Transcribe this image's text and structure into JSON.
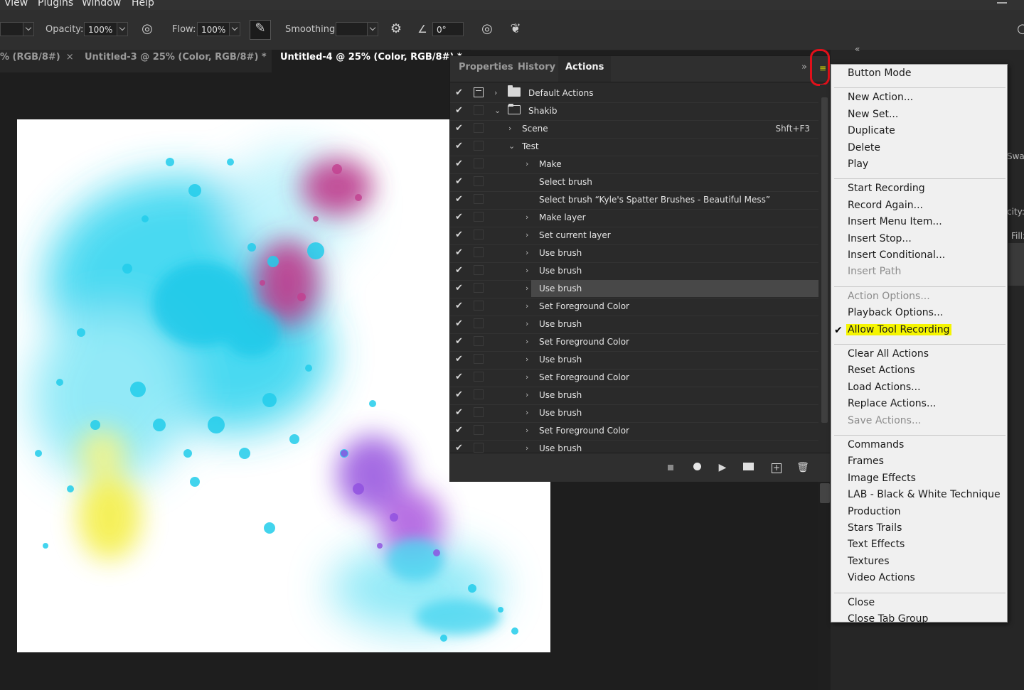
{
  "menubar": {
    "items": [
      "View",
      "Plugins",
      "Window",
      "Help"
    ]
  },
  "options": {
    "opacity_label": "Opacity:",
    "opacity_value": "100%",
    "flow_label": "Flow:",
    "flow_value": "100%",
    "smoothing_label": "Smoothing:",
    "smoothing_value": "",
    "angle_value": "0°"
  },
  "doc_tabs": [
    {
      "label": "% (RGB/8#)",
      "close": "×"
    },
    {
      "label": "Untitled-3 @ 25% (Color, RGB/8#) *",
      "close": "×"
    },
    {
      "label": "Untitled-4 @ 25% (Color, RGB/8#) *",
      "close": ""
    }
  ],
  "panel": {
    "tabs": [
      "Properties",
      "History",
      "Actions"
    ],
    "active_tab": "Actions",
    "collapse_glyph": "»",
    "menu_glyph": "≡",
    "rows": [
      {
        "label": "Default Actions",
        "type": "set",
        "toggle": "›",
        "shortcut": ""
      },
      {
        "label": "Shakib",
        "type": "set-open",
        "toggle": "⌄",
        "shortcut": ""
      },
      {
        "label": "Scene",
        "type": "action",
        "toggle": "›",
        "shortcut": "Shft+F3"
      },
      {
        "label": "Test",
        "type": "action-open",
        "toggle": "⌄",
        "shortcut": ""
      },
      {
        "label": "Make",
        "type": "step",
        "toggle": "›",
        "shortcut": ""
      },
      {
        "label": "Select brush",
        "type": "step",
        "toggle": "",
        "shortcut": ""
      },
      {
        "label": "Select brush “Kyle's Spatter Brushes - Beautiful Mess”",
        "type": "step",
        "toggle": "",
        "shortcut": ""
      },
      {
        "label": "Make layer",
        "type": "step",
        "toggle": "›",
        "shortcut": ""
      },
      {
        "label": "Set current layer",
        "type": "step",
        "toggle": "›",
        "shortcut": ""
      },
      {
        "label": "Use brush",
        "type": "step",
        "toggle": "›",
        "shortcut": ""
      },
      {
        "label": "Use brush",
        "type": "step",
        "toggle": "›",
        "shortcut": ""
      },
      {
        "label": "Use brush",
        "type": "step",
        "toggle": "›",
        "shortcut": "",
        "selected": true
      },
      {
        "label": "Set Foreground Color",
        "type": "step",
        "toggle": "›",
        "shortcut": ""
      },
      {
        "label": "Use brush",
        "type": "step",
        "toggle": "›",
        "shortcut": ""
      },
      {
        "label": "Set Foreground Color",
        "type": "step",
        "toggle": "›",
        "shortcut": ""
      },
      {
        "label": "Use brush",
        "type": "step",
        "toggle": "›",
        "shortcut": ""
      },
      {
        "label": "Set Foreground Color",
        "type": "step",
        "toggle": "›",
        "shortcut": ""
      },
      {
        "label": "Use brush",
        "type": "step",
        "toggle": "›",
        "shortcut": ""
      },
      {
        "label": "Use brush",
        "type": "step",
        "toggle": "›",
        "shortcut": ""
      },
      {
        "label": "Set Foreground Color",
        "type": "step",
        "toggle": "›",
        "shortcut": ""
      },
      {
        "label": "Use brush",
        "type": "step",
        "toggle": "›",
        "shortcut": ""
      }
    ],
    "footer_icons": [
      "stop-icon",
      "record-icon",
      "play-icon",
      "new-set-icon",
      "new-action-icon",
      "trash-icon"
    ]
  },
  "dock": {
    "collapse_glyph": "«",
    "swatches_fragment": "Swat",
    "opacity_fragment": "city:",
    "fill_fragment": "Fill:"
  },
  "flyout": {
    "check_glyph": "✔",
    "groups": [
      [
        {
          "label": "Button Mode"
        }
      ],
      [
        {
          "label": "New Action..."
        },
        {
          "label": "New Set..."
        },
        {
          "label": "Duplicate"
        },
        {
          "label": "Delete"
        },
        {
          "label": "Play"
        }
      ],
      [
        {
          "label": "Start Recording"
        },
        {
          "label": "Record Again..."
        },
        {
          "label": "Insert Menu Item..."
        },
        {
          "label": "Insert Stop..."
        },
        {
          "label": "Insert Conditional..."
        },
        {
          "label": "Insert Path",
          "disabled": true
        }
      ],
      [
        {
          "label": "Action Options...",
          "disabled": true
        },
        {
          "label": "Playback Options..."
        },
        {
          "label": "Allow Tool Recording",
          "checked": true,
          "highlighted": true
        }
      ],
      [
        {
          "label": "Clear All Actions"
        },
        {
          "label": "Reset Actions"
        },
        {
          "label": "Load Actions..."
        },
        {
          "label": "Replace Actions..."
        },
        {
          "label": "Save Actions...",
          "disabled": true
        }
      ],
      [
        {
          "label": "Commands"
        },
        {
          "label": "Frames"
        },
        {
          "label": "Image Effects"
        },
        {
          "label": "LAB - Black & White Technique"
        },
        {
          "label": "Production"
        },
        {
          "label": "Stars Trails"
        },
        {
          "label": "Text Effects"
        },
        {
          "label": "Textures"
        },
        {
          "label": "Video Actions"
        }
      ],
      [
        {
          "label": "Close"
        },
        {
          "label": "Close Tab Group"
        }
      ]
    ]
  },
  "colors": {
    "highlight": "#f5f500",
    "annotation": "#e0101a",
    "splatter_cyan": "#29d3ef",
    "splatter_magenta": "#c03a8c",
    "splatter_violet": "#9b5ce0",
    "splatter_yellow": "#f4ef4a"
  }
}
